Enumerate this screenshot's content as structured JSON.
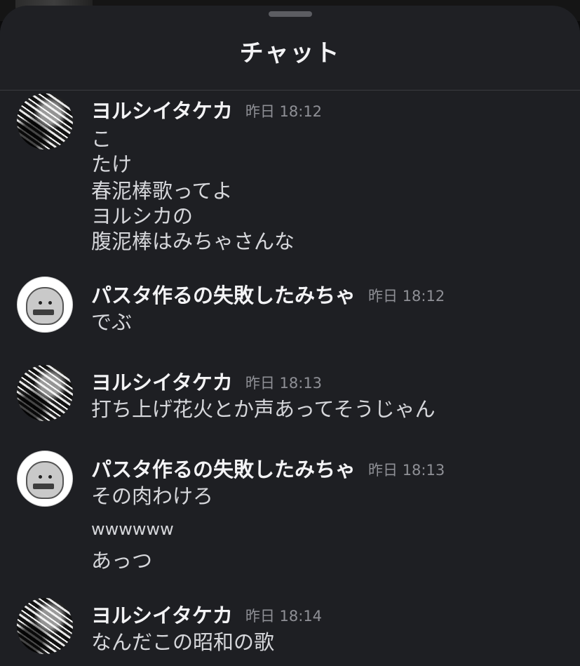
{
  "sheet": {
    "title": "チャット"
  },
  "messages": [
    {
      "author": "ヨルシイタケカ",
      "time": "昨日 18:12",
      "avatar": "manga-avatar",
      "lines": [
        "こ",
        "たけ",
        "春泥棒歌ってよ",
        "ヨルシカの",
        "腹泥棒はみちゃさんな"
      ]
    },
    {
      "author": "パスタ作るの失敗したみちゃ",
      "time": "昨日 18:12",
      "avatar": "mascot-avatar",
      "lines": [
        "でぶ"
      ]
    },
    {
      "author": "ヨルシイタケカ",
      "time": "昨日 18:13",
      "avatar": "manga-avatar",
      "lines": [
        "打ち上げ花火とか声あってそうじゃん"
      ]
    },
    {
      "author": "パスタ作るの失敗したみちゃ",
      "time": "昨日 18:13",
      "avatar": "mascot-avatar",
      "lines": [
        "その肉わけろ",
        "wwwwww",
        "あっつ"
      ]
    },
    {
      "author": "ヨルシイタケカ",
      "time": "昨日 18:14",
      "avatar": "manga-avatar",
      "lines": [
        "なんだこの昭和の歌"
      ]
    }
  ]
}
